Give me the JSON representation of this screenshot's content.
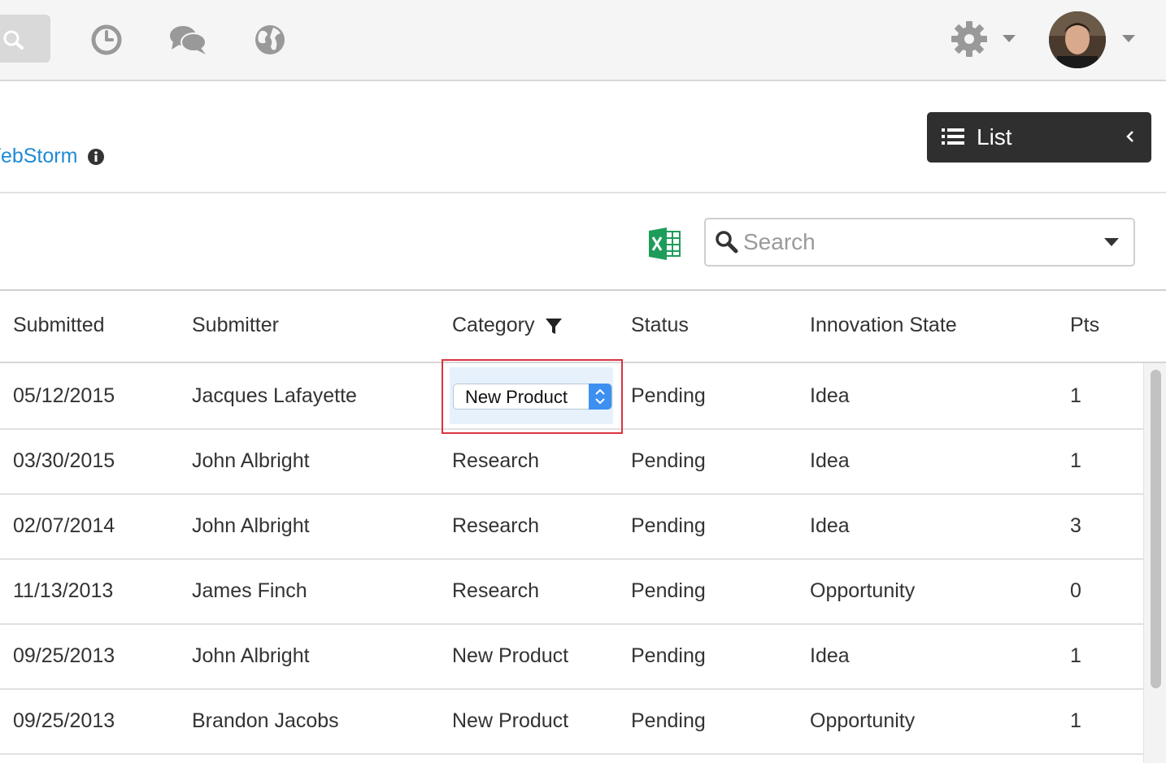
{
  "topbar": {
    "icons": [
      "search-icon",
      "clock-icon",
      "chat-icon",
      "globe-icon",
      "gear-icon",
      "user-avatar"
    ]
  },
  "header": {
    "project_link": "/ebStorm",
    "list_button_label": "List"
  },
  "toolbar": {
    "search_placeholder": "Search",
    "export_icon": "excel-icon"
  },
  "table": {
    "columns": [
      "Submitted",
      "Submitter",
      "Category",
      "Status",
      "Innovation State",
      "Pts"
    ],
    "rows": [
      [
        "05/12/2015",
        "Jacques Lafayette",
        "New Product",
        "Pending",
        "Idea",
        "1"
      ],
      [
        "03/30/2015",
        "John Albright",
        "Research",
        "Pending",
        "Idea",
        "1"
      ],
      [
        "02/07/2014",
        "John Albright",
        "Research",
        "Pending",
        "Idea",
        "3"
      ],
      [
        "11/13/2013",
        "James Finch",
        "Research",
        "Pending",
        "Opportunity",
        "0"
      ],
      [
        "09/25/2013",
        "John Albright",
        "New Product",
        "Pending",
        "Idea",
        "1"
      ],
      [
        "09/25/2013",
        "Brandon Jacobs",
        "New Product",
        "Pending",
        "Opportunity",
        "1"
      ]
    ]
  },
  "colors": {
    "link": "#1f8ad6",
    "highlight_border": "#d9333f",
    "select_arrow": "#3d8ff0",
    "dark_button": "#2f2f2f"
  }
}
